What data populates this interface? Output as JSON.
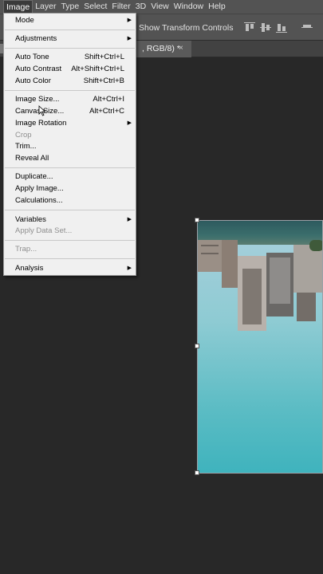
{
  "menubar": {
    "items": [
      {
        "label": "Image",
        "active": true
      },
      {
        "label": "Layer"
      },
      {
        "label": "Type"
      },
      {
        "label": "Select"
      },
      {
        "label": "Filter"
      },
      {
        "label": "3D"
      },
      {
        "label": "View"
      },
      {
        "label": "Window"
      },
      {
        "label": "Help"
      }
    ]
  },
  "options": {
    "transform_label": "Show Transform Controls",
    "align_icons": [
      "align-top-edges-icon",
      "align-vertical-centers-icon",
      "align-bottom-edges-icon",
      "distribute-icon"
    ]
  },
  "document_tab": {
    "title": ", RGB/8) *",
    "close": "×"
  },
  "image_menu": {
    "items": [
      {
        "label": "Mode",
        "shortcut": "",
        "submenu": true,
        "disabled": false
      },
      {
        "label": "Adjustments",
        "shortcut": "",
        "submenu": true,
        "disabled": false
      },
      {
        "label": "Auto Tone",
        "shortcut": "Shift+Ctrl+L",
        "submenu": false,
        "disabled": false
      },
      {
        "label": "Auto Contrast",
        "shortcut": "Alt+Shift+Ctrl+L",
        "submenu": false,
        "disabled": false
      },
      {
        "label": "Auto Color",
        "shortcut": "Shift+Ctrl+B",
        "submenu": false,
        "disabled": false
      },
      {
        "label": "Image Size...",
        "shortcut": "Alt+Ctrl+I",
        "submenu": false,
        "disabled": false
      },
      {
        "label": "Canvas Size...",
        "shortcut": "Alt+Ctrl+C",
        "submenu": false,
        "disabled": false
      },
      {
        "label": "Image Rotation",
        "shortcut": "",
        "submenu": true,
        "disabled": false
      },
      {
        "label": "Crop",
        "shortcut": "",
        "submenu": false,
        "disabled": true
      },
      {
        "label": "Trim...",
        "shortcut": "",
        "submenu": false,
        "disabled": false
      },
      {
        "label": "Reveal All",
        "shortcut": "",
        "submenu": false,
        "disabled": false
      },
      {
        "label": "Duplicate...",
        "shortcut": "",
        "submenu": false,
        "disabled": false
      },
      {
        "label": "Apply Image...",
        "shortcut": "",
        "submenu": false,
        "disabled": false
      },
      {
        "label": "Calculations...",
        "shortcut": "",
        "submenu": false,
        "disabled": false
      },
      {
        "label": "Variables",
        "shortcut": "",
        "submenu": true,
        "disabled": false
      },
      {
        "label": "Apply Data Set...",
        "shortcut": "",
        "submenu": false,
        "disabled": true
      },
      {
        "label": "Trap...",
        "shortcut": "",
        "submenu": false,
        "disabled": true
      },
      {
        "label": "Analysis",
        "shortcut": "",
        "submenu": true,
        "disabled": false
      }
    ]
  },
  "colors": {
    "menubar_bg": "#535353",
    "workspace_bg": "#282828",
    "menu_bg": "#f0f0f0",
    "disabled_text": "#8f8f8f"
  }
}
